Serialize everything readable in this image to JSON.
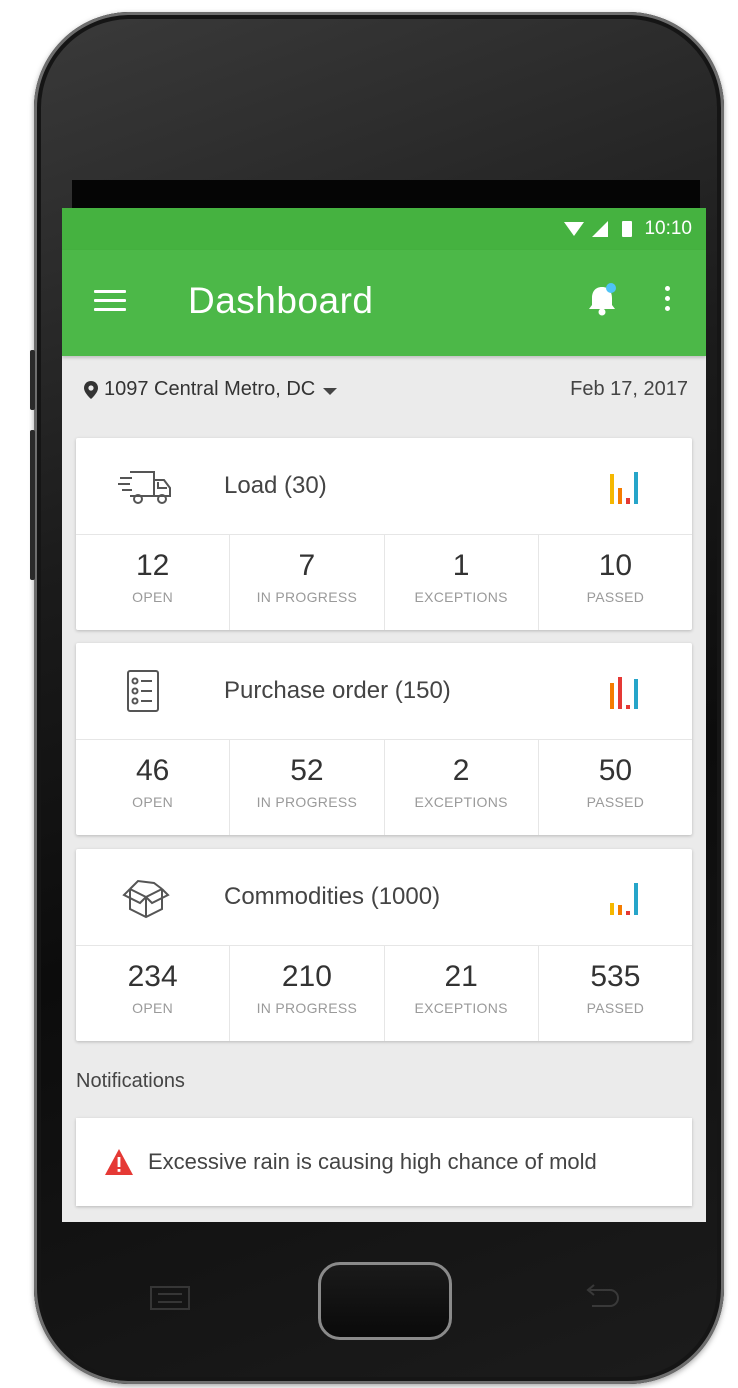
{
  "statusbar": {
    "time": "10:10"
  },
  "appbar": {
    "title": "Dashboard",
    "notification_dot_color": "#4fc3f7"
  },
  "location": {
    "name": "1097 Central Metro, DC",
    "date": "Feb 17, 2017"
  },
  "cards": [
    {
      "title": "Load (30)",
      "icon": "truck-icon",
      "stats": [
        {
          "value": "12",
          "label": "OPEN"
        },
        {
          "value": "7",
          "label": "IN PROGRESS"
        },
        {
          "value": "1",
          "label": "EXCEPTIONS"
        },
        {
          "value": "10",
          "label": "PASSED"
        }
      ]
    },
    {
      "title": "Purchase order (150)",
      "icon": "checklist-icon",
      "stats": [
        {
          "value": "46",
          "label": "OPEN"
        },
        {
          "value": "52",
          "label": "IN PROGRESS"
        },
        {
          "value": "2",
          "label": "EXCEPTIONS"
        },
        {
          "value": "50",
          "label": "PASSED"
        }
      ]
    },
    {
      "title": "Commodities (1000)",
      "icon": "box-icon",
      "stats": [
        {
          "value": "234",
          "label": "OPEN"
        },
        {
          "value": "210",
          "label": "IN PROGRESS"
        },
        {
          "value": "21",
          "label": "EXCEPTIONS"
        },
        {
          "value": "535",
          "label": "PASSED"
        }
      ]
    }
  ],
  "notifications": {
    "heading": "Notifications",
    "items": [
      {
        "text": "Excessive rain is causing high chance of mold",
        "icon": "warning-icon"
      }
    ]
  },
  "colors": {
    "statusbar": "#45b240",
    "appbar": "#4cb848",
    "chart_yellow": "#f5b800",
    "chart_orange": "#f57c00",
    "chart_red": "#e53935",
    "chart_blue": "#26a5c9",
    "warning": "#e53935"
  }
}
